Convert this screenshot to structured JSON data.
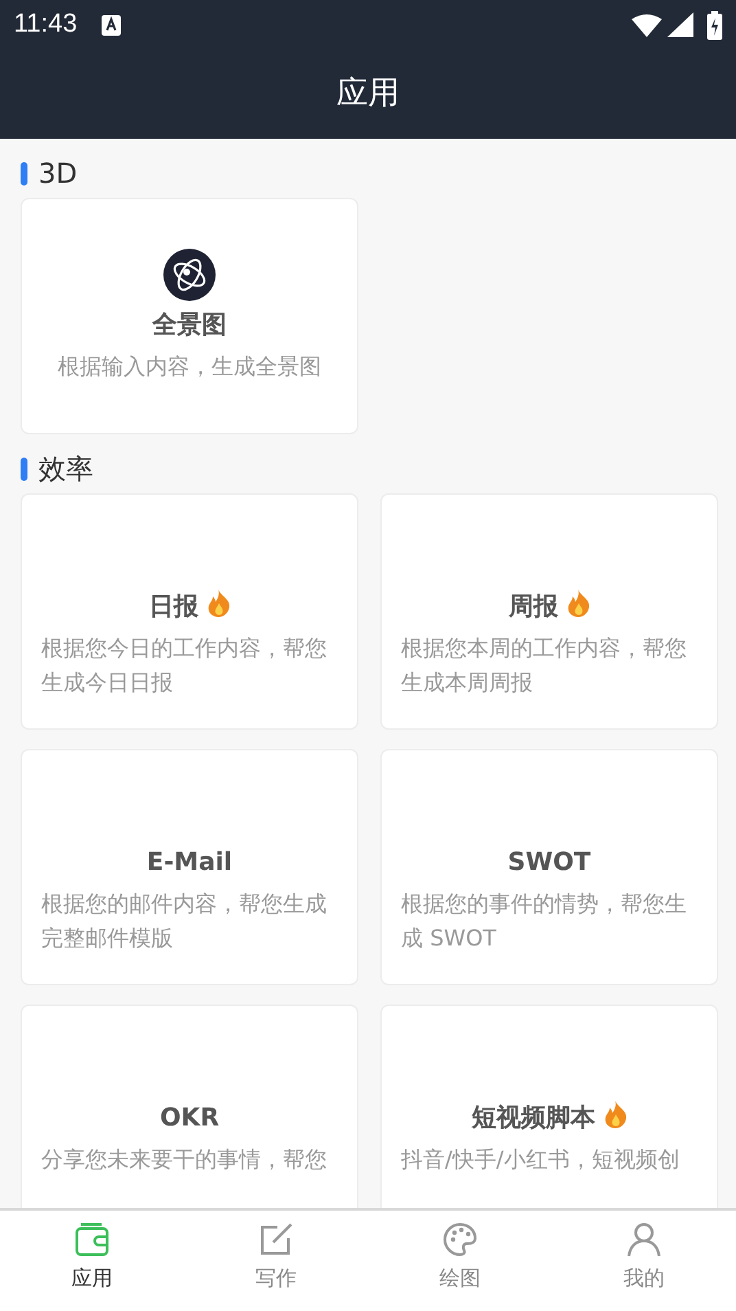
{
  "status_bar": {
    "time": "11:43"
  },
  "header": {
    "title": "应用"
  },
  "sections": [
    {
      "title": "3D",
      "kind": "feature",
      "cards": [
        {
          "title": "全景图",
          "description": "根据输入内容，生成全景图",
          "hot": false,
          "has_icon": true
        }
      ]
    },
    {
      "title": "效率",
      "kind": "grid",
      "cards": [
        {
          "title": "日报",
          "description": "根据您今日的工作内容，帮您生成今日日报",
          "hot": true,
          "has_icon": false
        },
        {
          "title": "周报",
          "description": "根据您本周的工作内容，帮您生成本周周报",
          "hot": true,
          "has_icon": false
        },
        {
          "title": "E-Mail",
          "description": "根据您的邮件内容，帮您生成完整邮件模版",
          "hot": false,
          "has_icon": false
        },
        {
          "title": "SWOT",
          "description": "根据您的事件的情势，帮您生成 SWOT",
          "hot": false,
          "has_icon": false
        },
        {
          "title": "OKR",
          "description": "分享您未来要干的事情，帮您",
          "hot": false,
          "has_icon": false
        },
        {
          "title": "短视频脚本",
          "description": "抖音/快手/小红书，短视频创",
          "hot": true,
          "has_icon": false
        }
      ]
    }
  ],
  "tab_bar": [
    {
      "label": "应用",
      "kind": "wallet",
      "selected": true
    },
    {
      "label": "写作",
      "kind": "edit",
      "selected": false
    },
    {
      "label": "绘图",
      "kind": "palette",
      "selected": false
    },
    {
      "label": "我的",
      "kind": "person",
      "selected": false
    }
  ]
}
